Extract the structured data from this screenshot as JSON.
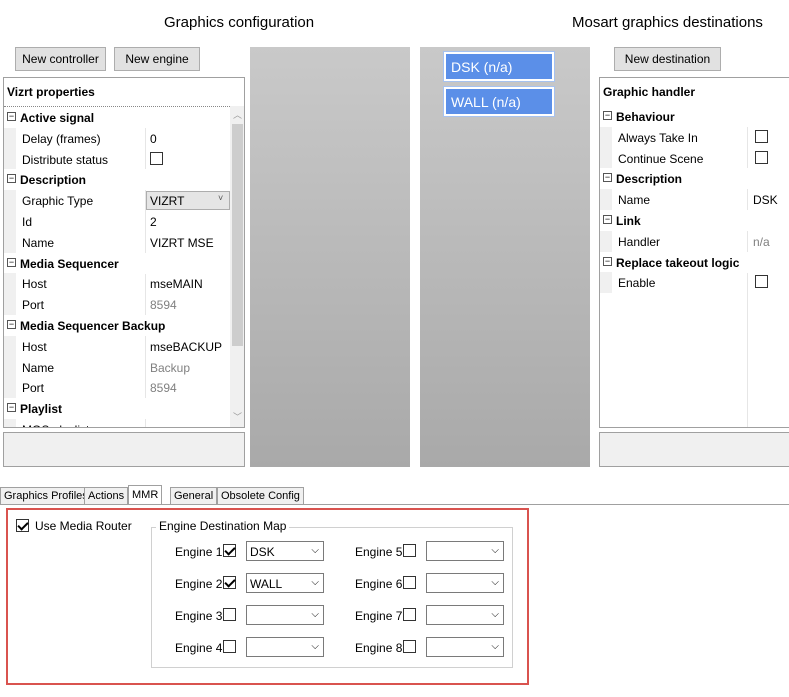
{
  "headings": {
    "left": "Graphics configuration",
    "right": "Mosart graphics destinations"
  },
  "buttons": {
    "new_controller": "New controller",
    "new_engine": "New engine",
    "new_destination": "New destination"
  },
  "left_panel": {
    "title": "Vizrt properties",
    "rows": [
      {
        "kind": "cat",
        "label": "Active signal"
      },
      {
        "kind": "prop",
        "name": "Delay (frames)",
        "value": "0"
      },
      {
        "kind": "prop",
        "name": "Distribute status",
        "checkbox": true
      },
      {
        "kind": "cat",
        "label": "Description"
      },
      {
        "kind": "prop",
        "name": "Graphic Type",
        "value": "VIZRT",
        "combo": true
      },
      {
        "kind": "prop",
        "name": "Id",
        "value": "2"
      },
      {
        "kind": "prop",
        "name": "Name",
        "value": "VIZRT MSE"
      },
      {
        "kind": "cat",
        "label": "Media Sequencer"
      },
      {
        "kind": "prop",
        "name": "Host",
        "value": "mseMAIN"
      },
      {
        "kind": "prop",
        "name": "Port",
        "value": "8594",
        "grey": true
      },
      {
        "kind": "cat",
        "label": "Media Sequencer Backup"
      },
      {
        "kind": "prop",
        "name": "Host",
        "value": "mseBACKUP"
      },
      {
        "kind": "prop",
        "name": "Name",
        "value": "Backup",
        "grey": true
      },
      {
        "kind": "prop",
        "name": "Port",
        "value": "8594",
        "grey": true
      },
      {
        "kind": "cat",
        "label": "Playlist"
      },
      {
        "kind": "prop",
        "name": "MOS playlist",
        "value": ""
      }
    ]
  },
  "destinations": [
    {
      "label": "DSK (n/a)"
    },
    {
      "label": "WALL (n/a)"
    }
  ],
  "right_panel": {
    "title": "Graphic handler",
    "rows": [
      {
        "kind": "cat",
        "label": "Behaviour"
      },
      {
        "kind": "prop",
        "name": "Always Take In",
        "checkbox": true
      },
      {
        "kind": "prop",
        "name": "Continue Scene",
        "checkbox": true
      },
      {
        "kind": "cat",
        "label": "Description"
      },
      {
        "kind": "prop",
        "name": "Name",
        "value": "DSK"
      },
      {
        "kind": "cat",
        "label": "Link"
      },
      {
        "kind": "prop",
        "name": "Handler",
        "value": "n/a",
        "grey": true
      },
      {
        "kind": "cat",
        "label": "Replace takeout logic"
      },
      {
        "kind": "prop",
        "name": "Enable",
        "checkbox": true
      }
    ]
  },
  "tabs": [
    {
      "label": "Graphics Profiles",
      "active": false
    },
    {
      "label": "Actions",
      "active": false
    },
    {
      "label": "MMR",
      "active": true
    },
    {
      "label": "General",
      "active": false
    },
    {
      "label": "Obsolete Config",
      "active": false
    }
  ],
  "mmr": {
    "use_media_router_label": "Use Media Router",
    "use_media_router_checked": true,
    "group_title": "Engine Destination Map",
    "engines": [
      {
        "label": "Engine 1",
        "checked": true,
        "value": "DSK"
      },
      {
        "label": "Engine 2",
        "checked": true,
        "value": "WALL"
      },
      {
        "label": "Engine 3",
        "checked": false,
        "value": ""
      },
      {
        "label": "Engine 4",
        "checked": false,
        "value": ""
      },
      {
        "label": "Engine 5",
        "checked": false,
        "value": ""
      },
      {
        "label": "Engine 6",
        "checked": false,
        "value": ""
      },
      {
        "label": "Engine 7",
        "checked": false,
        "value": ""
      },
      {
        "label": "Engine 8",
        "checked": false,
        "value": ""
      }
    ]
  },
  "colors": {
    "destination_blue": "#5b8fe8",
    "highlight_red": "#d9534f",
    "gradient_top": "#c8c8c8",
    "gradient_bottom": "#a8a8a8"
  },
  "icons": {
    "expand": "minus-box-icon",
    "dropdown": "chevron-down-icon",
    "scroll_up": "chevron-up-icon",
    "scroll_down": "chevron-down-icon"
  }
}
